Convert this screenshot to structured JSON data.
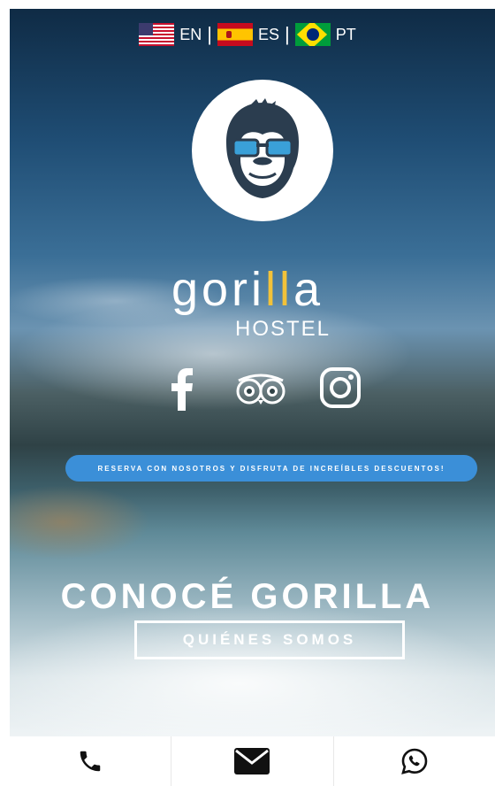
{
  "languages": [
    {
      "code": "EN",
      "flag": "us-flag"
    },
    {
      "code": "ES",
      "flag": "spain-flag"
    },
    {
      "code": "PT",
      "flag": "brazil-flag"
    }
  ],
  "separator": "|",
  "brand": {
    "wordmark_a": "gori",
    "wordmark_b": "ll",
    "wordmark_c": "a",
    "sub": "HOSTEL",
    "logo_icon": "gorilla-with-sunglasses-icon",
    "accent_color": "#f2c23a",
    "shades_color": "#3aa0d8"
  },
  "socials": [
    {
      "name": "facebook-icon"
    },
    {
      "name": "tripadvisor-icon"
    },
    {
      "name": "instagram-icon"
    }
  ],
  "promo_text": "RESERVA CON NOSOTROS Y DISFRUTA DE INCREÍBLES DESCUENTOS!",
  "promo_color": "#3b8fd8",
  "headline": "CONOCÉ GORILLA",
  "cta_label": "QUIÉNES SOMOS",
  "bottom_bar": [
    {
      "icon": "phone-icon"
    },
    {
      "icon": "envelope-icon"
    },
    {
      "icon": "whatsapp-icon"
    }
  ]
}
